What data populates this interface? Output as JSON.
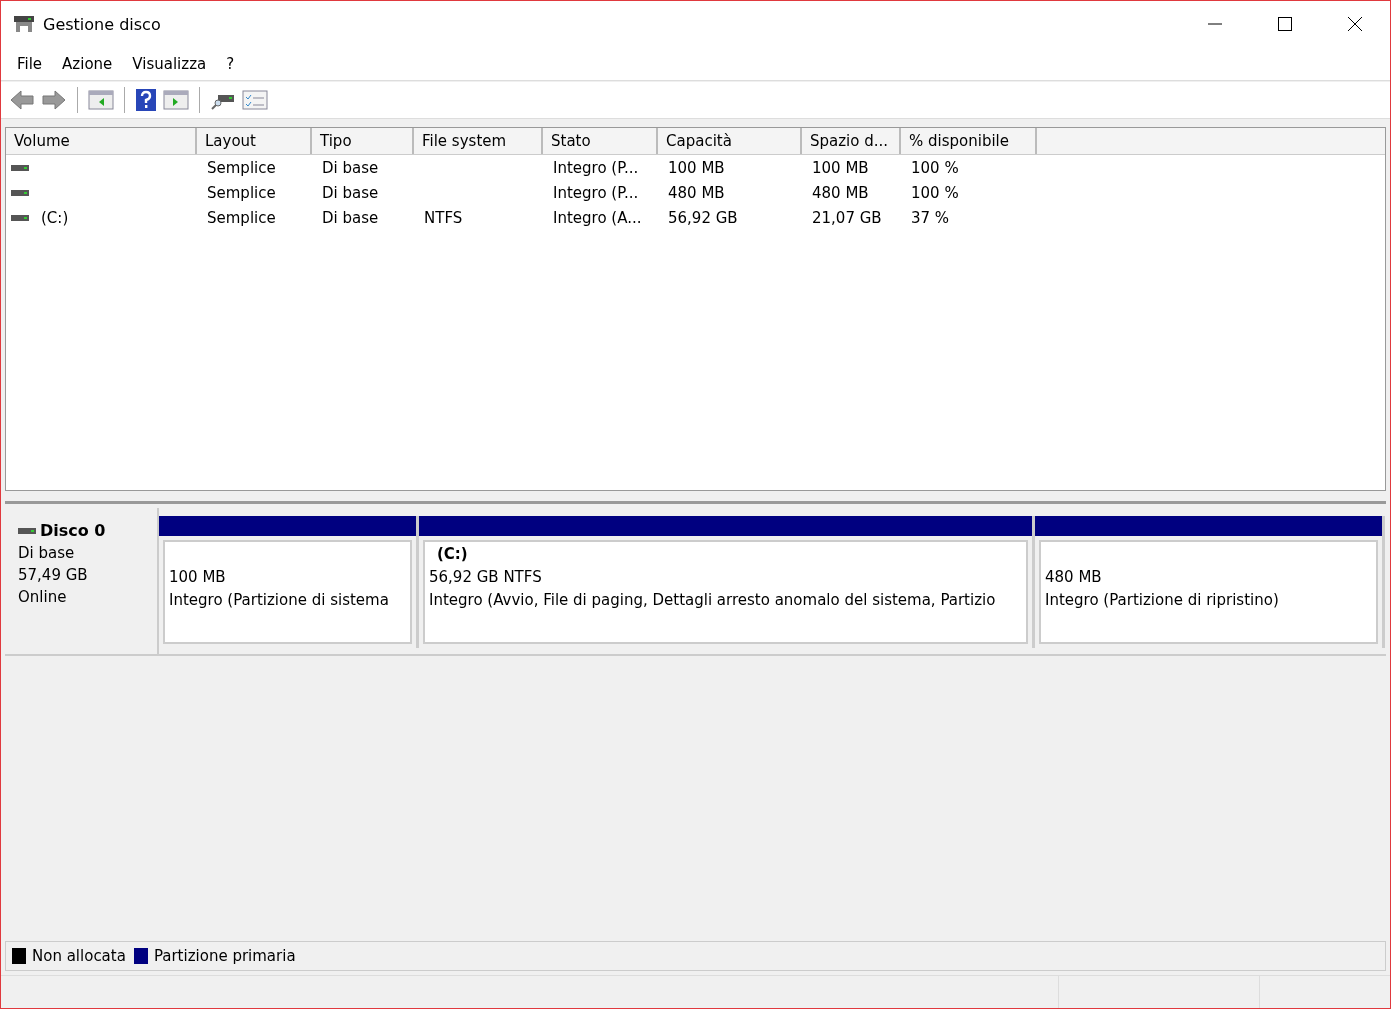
{
  "window": {
    "title": "Gestione disco"
  },
  "menu": [
    "File",
    "Azione",
    "Visualizza",
    "?"
  ],
  "table": {
    "columns": [
      "Volume",
      "Layout",
      "Tipo",
      "File system",
      "Stato",
      "Capacità",
      "Spazio d...",
      "% disponibile"
    ],
    "rows": [
      {
        "cells": [
          "",
          "Semplice",
          "Di base",
          "",
          "Integro (P...",
          "100 MB",
          "100 MB",
          "100 %"
        ]
      },
      {
        "cells": [
          "",
          "Semplice",
          "Di base",
          "",
          "Integro (P...",
          "480 MB",
          "480 MB",
          "100 %"
        ]
      },
      {
        "cells": [
          "(C:)",
          "Semplice",
          "Di base",
          "NTFS",
          "Integro (A...",
          "56,92 GB",
          "21,07 GB",
          "37 %"
        ]
      }
    ]
  },
  "disk": {
    "name": "Disco 0",
    "type": "Di base",
    "size": "57,49 GB",
    "status": "Online",
    "partitions": [
      {
        "lines": [
          "100 MB",
          "Integro (Partizione di sistema"
        ]
      },
      {
        "title": "(C:)",
        "lines": [
          "56,92 GB NTFS",
          "Integro (Avvio, File di paging, Dettagli arresto anomalo del sistema, Partizio"
        ]
      },
      {
        "lines": [
          "480 MB",
          "Integro (Partizione di ripristino)"
        ]
      }
    ]
  },
  "legend": [
    {
      "label": "Non allocata",
      "color": "#000000"
    },
    {
      "label": "Partizione primaria",
      "color": "#000080"
    }
  ]
}
